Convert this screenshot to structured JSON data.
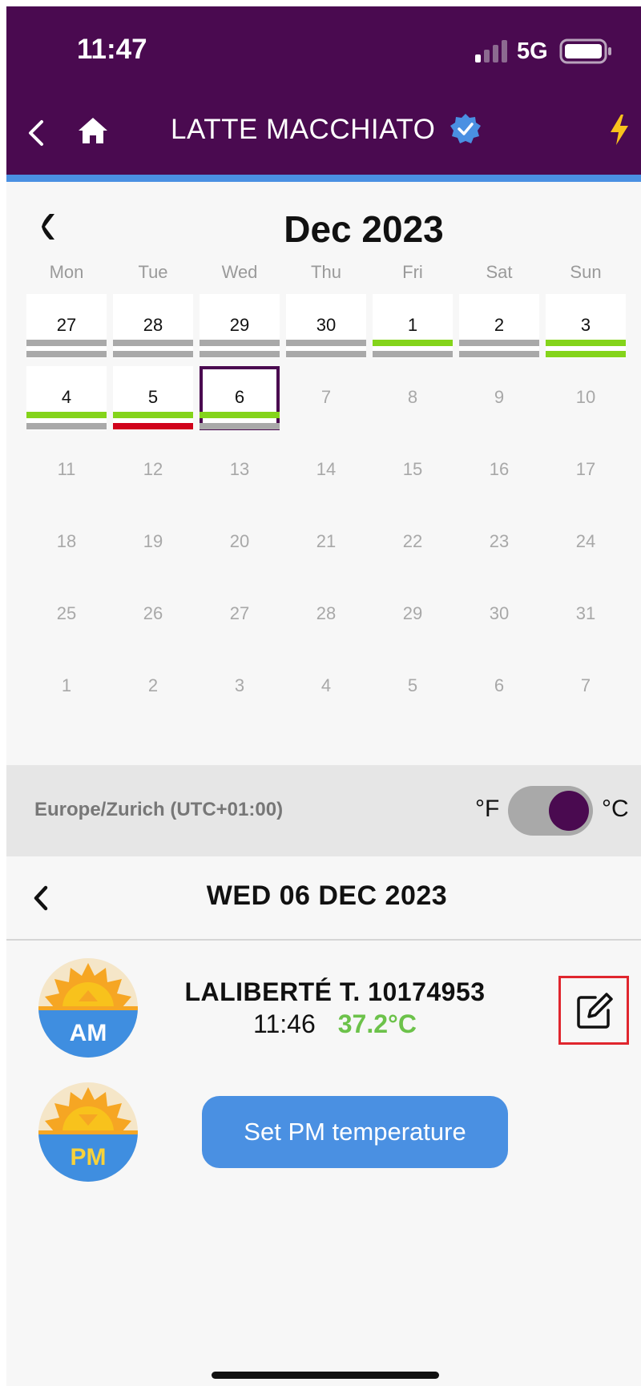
{
  "status_bar": {
    "time": "11:47",
    "network": "5G"
  },
  "header": {
    "title": "LATTE MACCHIATO"
  },
  "calendar": {
    "month_title": "Dec 2023",
    "weekdays": [
      "Mon",
      "Tue",
      "Wed",
      "Thu",
      "Fri",
      "Sat",
      "Sun"
    ],
    "days": [
      {
        "label": "27",
        "active": true,
        "bars": [
          "#a9a9a9",
          "#a9a9a9"
        ]
      },
      {
        "label": "28",
        "active": true,
        "bars": [
          "#a9a9a9",
          "#a9a9a9"
        ]
      },
      {
        "label": "29",
        "active": true,
        "bars": [
          "#a9a9a9",
          "#a9a9a9"
        ]
      },
      {
        "label": "30",
        "active": true,
        "bars": [
          "#a9a9a9",
          "#a9a9a9"
        ]
      },
      {
        "label": "1",
        "active": true,
        "bars": [
          "#84d41a",
          "#a9a9a9"
        ]
      },
      {
        "label": "2",
        "active": true,
        "bars": [
          "#a9a9a9",
          "#a9a9a9"
        ]
      },
      {
        "label": "3",
        "active": true,
        "bars": [
          "#84d41a",
          "#84d41a"
        ]
      },
      {
        "label": "4",
        "active": true,
        "bars": [
          "#84d41a",
          "#a9a9a9"
        ]
      },
      {
        "label": "5",
        "active": true,
        "bars": [
          "#84d41a",
          "#d0021b"
        ]
      },
      {
        "label": "6",
        "active": true,
        "selected": true,
        "bars": [
          "#84d41a",
          "#a9a9a9"
        ]
      },
      {
        "label": "7",
        "active": false
      },
      {
        "label": "8",
        "active": false
      },
      {
        "label": "9",
        "active": false
      },
      {
        "label": "10",
        "active": false
      },
      {
        "label": "11",
        "active": false
      },
      {
        "label": "12",
        "active": false
      },
      {
        "label": "13",
        "active": false
      },
      {
        "label": "14",
        "active": false
      },
      {
        "label": "15",
        "active": false
      },
      {
        "label": "16",
        "active": false
      },
      {
        "label": "17",
        "active": false
      },
      {
        "label": "18",
        "active": false
      },
      {
        "label": "19",
        "active": false
      },
      {
        "label": "20",
        "active": false
      },
      {
        "label": "21",
        "active": false
      },
      {
        "label": "22",
        "active": false
      },
      {
        "label": "23",
        "active": false
      },
      {
        "label": "24",
        "active": false
      },
      {
        "label": "25",
        "active": false
      },
      {
        "label": "26",
        "active": false
      },
      {
        "label": "27",
        "active": false
      },
      {
        "label": "28",
        "active": false
      },
      {
        "label": "29",
        "active": false
      },
      {
        "label": "30",
        "active": false
      },
      {
        "label": "31",
        "active": false
      },
      {
        "label": "1",
        "active": false
      },
      {
        "label": "2",
        "active": false
      },
      {
        "label": "3",
        "active": false
      },
      {
        "label": "4",
        "active": false
      },
      {
        "label": "5",
        "active": false
      },
      {
        "label": "6",
        "active": false
      },
      {
        "label": "7",
        "active": false
      }
    ]
  },
  "timezone": {
    "label": "Europe/Zurich (UTC+01:00)",
    "unit_f": "°F",
    "unit_c": "°C",
    "selected_unit": "°C"
  },
  "day_view": {
    "title": "WED 06 DEC 2023"
  },
  "am_entry": {
    "badge": "AM",
    "name": "LALIBERTÉ T. 10174953",
    "time": "11:46",
    "temperature": "37.2°C"
  },
  "pm_entry": {
    "badge": "PM",
    "button_label": "Set PM temperature"
  },
  "colors": {
    "header_bg": "#4a0a50",
    "accent_blue": "#4a90e2",
    "ok_green": "#84d41a",
    "alert_red": "#d0021b",
    "neutral_gray": "#a9a9a9",
    "temp_green": "#6cc24a"
  }
}
